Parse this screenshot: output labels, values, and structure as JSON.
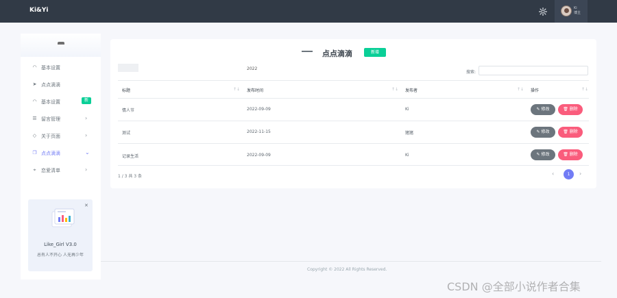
{
  "app": {
    "brand": "Ki&Yi"
  },
  "user": {
    "name_line1": "Ki",
    "name_line2": "博主"
  },
  "sidebar": {
    "items": [
      {
        "label": "基本设置",
        "icon": "speedometer-icon"
      },
      {
        "label": "点点滴滴",
        "icon": "send-icon"
      },
      {
        "label": "基本设置",
        "icon": "speedometer-icon",
        "badge": "新"
      },
      {
        "label": "留言管理",
        "icon": "list-icon"
      },
      {
        "label": "关于页面",
        "icon": "tag-icon"
      },
      {
        "label": "点点滴滴",
        "icon": "copy-icon"
      },
      {
        "label": "恋爱清单",
        "icon": "location-pin-icon"
      }
    ],
    "active_index": 5
  },
  "promo": {
    "title": "Like_Girl V3.0",
    "subtitle": "总有人不开心 人无再少年"
  },
  "main": {
    "title": "点点滴滴",
    "add_button": "新增",
    "date_stub": "2022",
    "search_label": "搜索:",
    "columns": [
      "标题",
      "发布时间",
      "发布者",
      "操作"
    ],
    "rows": [
      {
        "title": "情人节",
        "date": "2022-09-09",
        "author": "Ki"
      },
      {
        "title": "测试",
        "date": "2022-11-15",
        "author": "猪猪"
      },
      {
        "title": "记录生活",
        "date": "2022-09-09",
        "author": "Ki"
      }
    ],
    "edit_label": "修改",
    "delete_label": "删除",
    "info": "1 / 3 共 3 条",
    "current_page": "1"
  },
  "footer": {
    "copyright": "Copyright © 2022 All Rights Reserved."
  },
  "watermark": "CSDN @全部小说作者合集",
  "colors": {
    "topbar": "#313a46",
    "primary": "#727cf5",
    "success": "#0acf97",
    "danger": "#fa5c7c",
    "secondary": "#6c757d"
  }
}
